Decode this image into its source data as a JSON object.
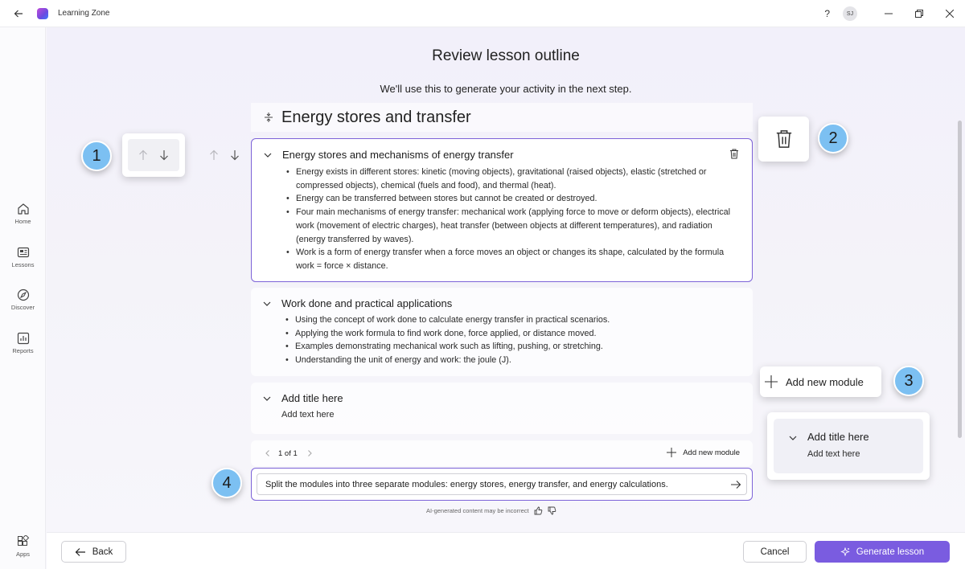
{
  "app": {
    "title": "Learning Zone",
    "avatar_initials": "SJ",
    "help": "?"
  },
  "rail": {
    "items": [
      {
        "label": "Home",
        "icon": "home-icon"
      },
      {
        "label": "Lessons",
        "icon": "lessons-icon"
      },
      {
        "label": "Discover",
        "icon": "discover-icon"
      },
      {
        "label": "Reports",
        "icon": "reports-icon"
      }
    ],
    "apps_label": "Apps"
  },
  "page": {
    "title": "Review lesson outline",
    "subtitle": "We'll use this to generate your activity in the next step."
  },
  "lesson": {
    "title": "Energy stores and transfer"
  },
  "modules": [
    {
      "title": "Energy stores and mechanisms of energy transfer",
      "bullets": [
        "Energy exists in different stores: kinetic (moving objects), gravitational (raised objects), elastic (stretched or compressed objects), chemical (fuels and food), and thermal (heat).",
        "Energy can be transferred between stores but cannot be created or destroyed.",
        "Four main mechanisms of energy transfer: mechanical work (applying force to move or deform objects), electrical work (movement of electric charges), heat transfer (between objects at different temperatures), and radiation (energy transferred by waves).",
        "Work is a form of energy transfer when a force moves an object or changes its shape, calculated by the formula work = force × distance."
      ]
    },
    {
      "title": "Work done and practical applications",
      "bullets": [
        "Using the concept of work done to calculate energy transfer in practical scenarios.",
        "Applying the work formula to find work done, force applied, or distance moved.",
        "Examples demonstrating mechanical work such as lifting, pushing, or stretching.",
        "Understanding the unit of energy and work: the joule (J)."
      ]
    },
    {
      "title": "Add title here",
      "text": "Add text here"
    }
  ],
  "pager": {
    "text": "1 of 1",
    "add_module": "Add new module"
  },
  "prompt": {
    "value": "Split the modules into three separate modules: energy stores, energy transfer, and energy calculations."
  },
  "disclaimer": "AI-generated content may be incorrect",
  "callouts": {
    "n1": "1",
    "n2": "2",
    "n3": "3",
    "n4": "4",
    "add_module": "Add new module",
    "new_title": "Add title here",
    "new_text": "Add text here"
  },
  "footer": {
    "back": "Back",
    "cancel": "Cancel",
    "generate": "Generate lesson"
  },
  "colors": {
    "accent": "#7a5ce0",
    "callout": "#7cc0f2",
    "selected_border": "#7d63d8"
  }
}
